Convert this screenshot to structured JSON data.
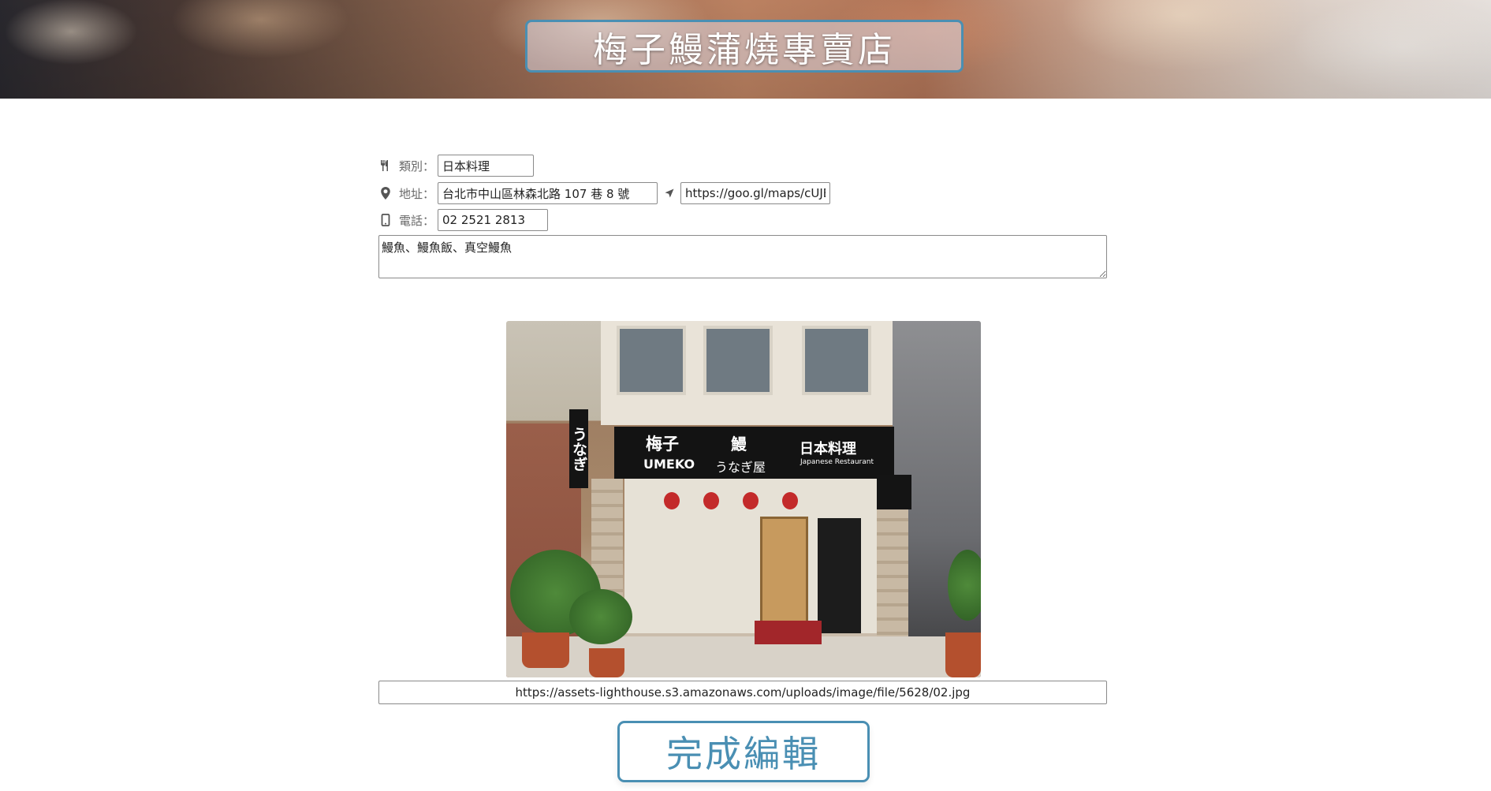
{
  "header": {
    "title": "梅子鰻蒲燒專賣店"
  },
  "form": {
    "category": {
      "icon": "utensils-icon",
      "label": "類別：",
      "value": "日本料理"
    },
    "address": {
      "icon": "map-marker-icon",
      "label": "地址：",
      "value": "台北市中山區林森北路 107 巷 8 號"
    },
    "map": {
      "icon": "location-arrow-icon",
      "value": "https://goo.gl/maps/cUJE"
    },
    "phone": {
      "icon": "mobile-phone-icon",
      "label": "電話：",
      "value": "02 2521 2813"
    },
    "description": {
      "value": "鰻魚、鰻魚飯、真空鰻魚"
    }
  },
  "photo": {
    "awning_name_zh": "梅子",
    "awning_name_en": "UMEKO",
    "awning_eel": "鰻",
    "awning_eel_kana": "うなぎ屋",
    "awning_cuisine": "日本料理",
    "awning_cuisine_en": "Japanese Restaurant",
    "sign_left": "うなぎ"
  },
  "image_url": {
    "value": "https://assets-lighthouse.s3.amazonaws.com/uploads/image/file/5628/02.jpg"
  },
  "actions": {
    "done_label": "完成編輯"
  },
  "colors": {
    "accent": "#4a8fb3",
    "input_border": "#8a8a8a"
  }
}
